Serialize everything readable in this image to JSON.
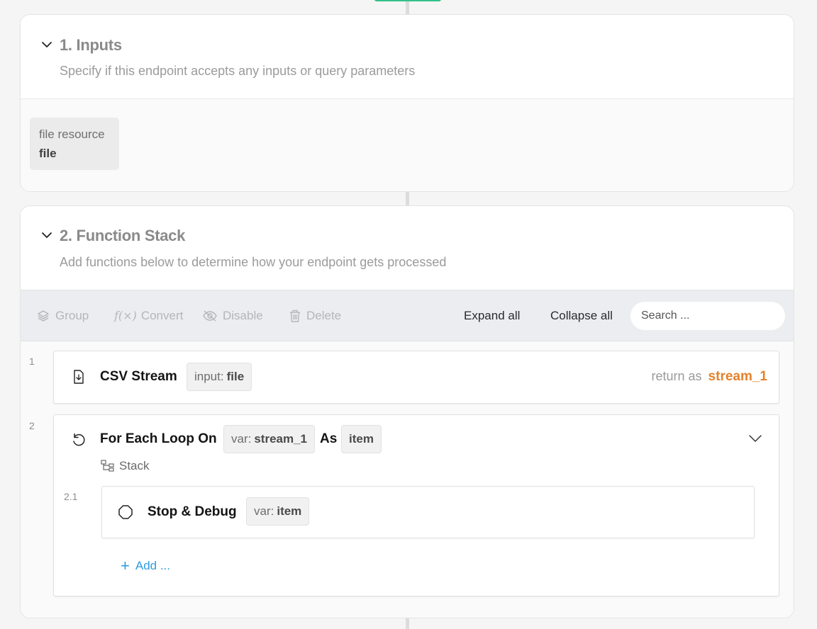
{
  "inputs": {
    "title": "1. Inputs",
    "subtitle": "Specify if this endpoint accepts any inputs or query parameters",
    "items": [
      {
        "type": "file resource",
        "name": "file"
      }
    ]
  },
  "function_stack": {
    "title": "2. Function Stack",
    "subtitle": "Add functions below to determine how your endpoint gets processed",
    "toolbar": {
      "group_label": "Group",
      "convert_label": "Convert",
      "disable_label": "Disable",
      "delete_label": "Delete",
      "expand_all_label": "Expand all",
      "collapse_all_label": "Collapse all",
      "search_placeholder": "Search ..."
    },
    "functions": [
      {
        "line": "1",
        "name": "CSV Stream",
        "tag_prefix": "input:",
        "tag_value": "file",
        "return_prefix": "return as",
        "return_value": "stream_1"
      },
      {
        "line": "2",
        "name": "For Each Loop On",
        "tag_prefix": "var:",
        "tag_value": "stream_1",
        "as_label": "As",
        "as_value": "item",
        "stack_label": "Stack",
        "children": [
          {
            "line": "2.1",
            "name": "Stop & Debug",
            "tag_prefix": "var:",
            "tag_value": "item"
          }
        ],
        "add_label": "Add ..."
      }
    ]
  },
  "colors": {
    "accent_orange": "#e3822c",
    "link_blue": "#2f9be0",
    "top_indicator_green": "#34c08a"
  }
}
